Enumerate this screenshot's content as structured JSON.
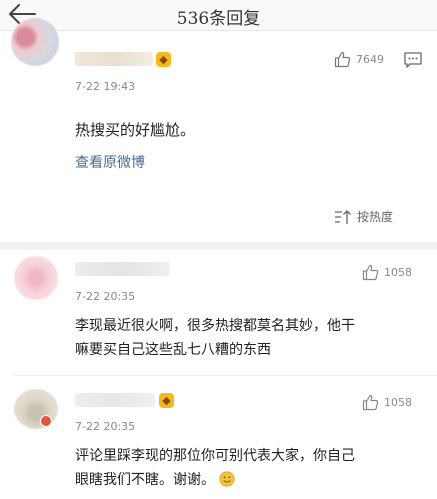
{
  "header": {
    "title": "536条回复"
  },
  "top_comment": {
    "time": "7-22  19:43",
    "likes": "7649",
    "text": "热搜买的好尴尬。",
    "view_original": "查看原微博",
    "sort_label": "按热度"
  },
  "replies": [
    {
      "time": "7-22  20:35",
      "likes": "1058",
      "line1": "李现最近很火啊，很多热搜都莫名其妙，他干",
      "line2": "嘛要买自己这些乱七八糟的东西"
    },
    {
      "time": "7-22  20:35",
      "likes": "1058",
      "line1": "评论里踩李现的那位你可别代表大家，你自己",
      "line2": "眼瞎我们不瞎。谢谢。"
    }
  ],
  "colors": {
    "link": "#4a6b93",
    "vip": "#f3b91f",
    "muted": "#8a8a8a"
  },
  "icons": [
    "back-arrow-icon",
    "thumb-up-icon",
    "comment-icon",
    "sort-icon",
    "vip-badge-icon",
    "smile-emoji-icon"
  ]
}
